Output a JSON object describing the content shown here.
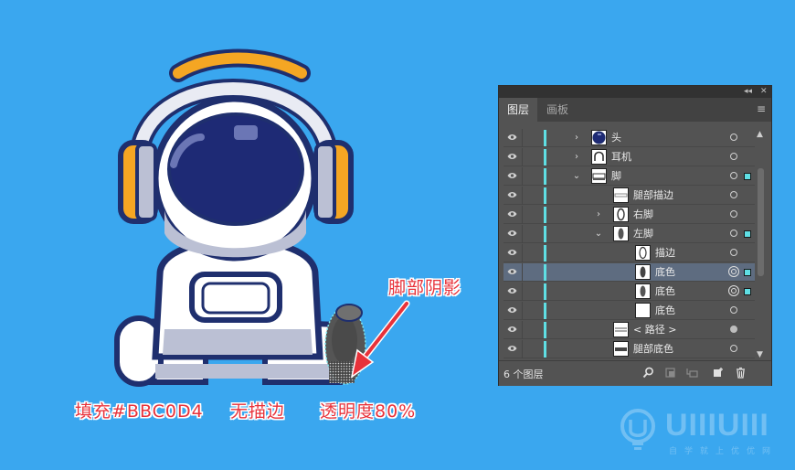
{
  "annotations": {
    "foot_shadow": "脚部阴影",
    "fill": "填充#BBC0D4",
    "no_stroke": "无描边",
    "opacity": "透明度80%"
  },
  "watermark": {
    "brand": "UIIIUIII",
    "subtitle": "自学就上优优网"
  },
  "panel": {
    "collapse_glyph": "◂◂",
    "close_glyph": "✕",
    "tabs": [
      "图层",
      "画板"
    ],
    "active_tab": "图层",
    "menu_glyph": "≡",
    "layers": [
      {
        "name": "头",
        "expander": "›",
        "target": "single",
        "selected_box": false,
        "row_selected": false
      },
      {
        "name": "耳机",
        "expander": "›",
        "target": "single",
        "selected_box": false,
        "row_selected": false
      },
      {
        "name": "脚",
        "expander": "⌄",
        "target": "single",
        "selected_box": true,
        "row_selected": false
      },
      {
        "name": "腿部描边",
        "expander": "",
        "target": "single",
        "selected_box": false,
        "row_selected": false
      },
      {
        "name": "右脚",
        "expander": "›",
        "target": "single",
        "selected_box": false,
        "row_selected": false
      },
      {
        "name": "左脚",
        "expander": "⌄",
        "target": "single",
        "selected_box": true,
        "row_selected": false
      },
      {
        "name": "描边",
        "expander": "",
        "target": "single",
        "selected_box": false,
        "row_selected": false
      },
      {
        "name": "底色",
        "expander": "",
        "target": "double",
        "selected_box": true,
        "row_selected": true
      },
      {
        "name": "底色",
        "expander": "",
        "target": "double",
        "selected_box": true,
        "row_selected": false
      },
      {
        "name": "底色",
        "expander": "",
        "target": "single",
        "selected_box": false,
        "row_selected": false
      },
      {
        "name": "< 路径 >",
        "expander": "",
        "target": "filled",
        "selected_box": false,
        "row_selected": false
      },
      {
        "name": "腿部底色",
        "expander": "",
        "target": "single",
        "selected_box": false,
        "row_selected": false
      }
    ],
    "footer": {
      "layer_count": "6 个图层"
    }
  },
  "colors": {
    "background": "#3aa7ef",
    "navy_outline": "#1f2f6e",
    "helmet_visor": "#1e2a75",
    "headphone_orange": "#f5a623",
    "body_white": "#ffffff",
    "shade_gray": "#bbc0d4",
    "layer_color_bar": "#5fdfe4",
    "annotation_red": "#e8323a"
  }
}
